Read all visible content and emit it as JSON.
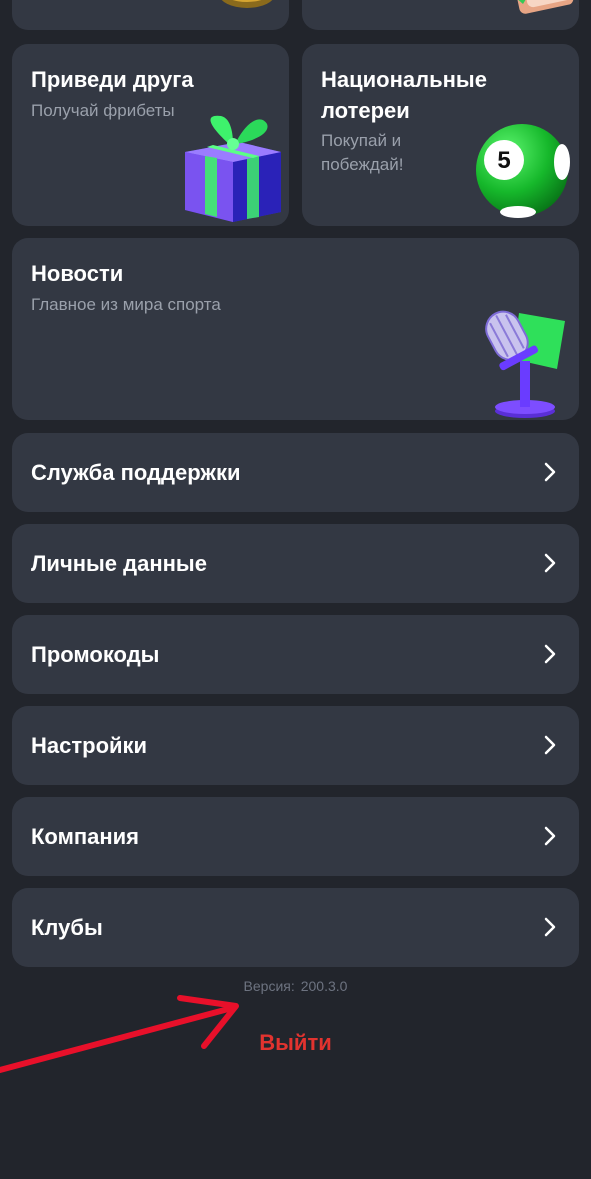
{
  "top_cards": [
    {
      "title": "Приведи друга",
      "subtitle": "Получай фрибеты"
    },
    {
      "title": "Национальные лотереи",
      "subtitle_line1": "Покупай и",
      "subtitle_line2": "побеждай!",
      "ball_number": "5"
    }
  ],
  "news_card": {
    "title": "Новости",
    "subtitle": "Главное из мира спорта"
  },
  "menu": [
    {
      "label": "Служба поддержки"
    },
    {
      "label": "Личные данные"
    },
    {
      "label": "Промокоды"
    },
    {
      "label": "Настройки"
    },
    {
      "label": "Компания"
    },
    {
      "label": "Клубы"
    }
  ],
  "version": {
    "label": "Версия:",
    "value": "200.3.0"
  },
  "logout_label": "Выйти",
  "colors": {
    "background": "#22252c",
    "card": "#333843",
    "logout": "#e2332f",
    "arrow": "#e8102a"
  },
  "icons": [
    "gift-icon",
    "lottery-ball-icon",
    "microphone-icon",
    "chevron-right-icon"
  ]
}
